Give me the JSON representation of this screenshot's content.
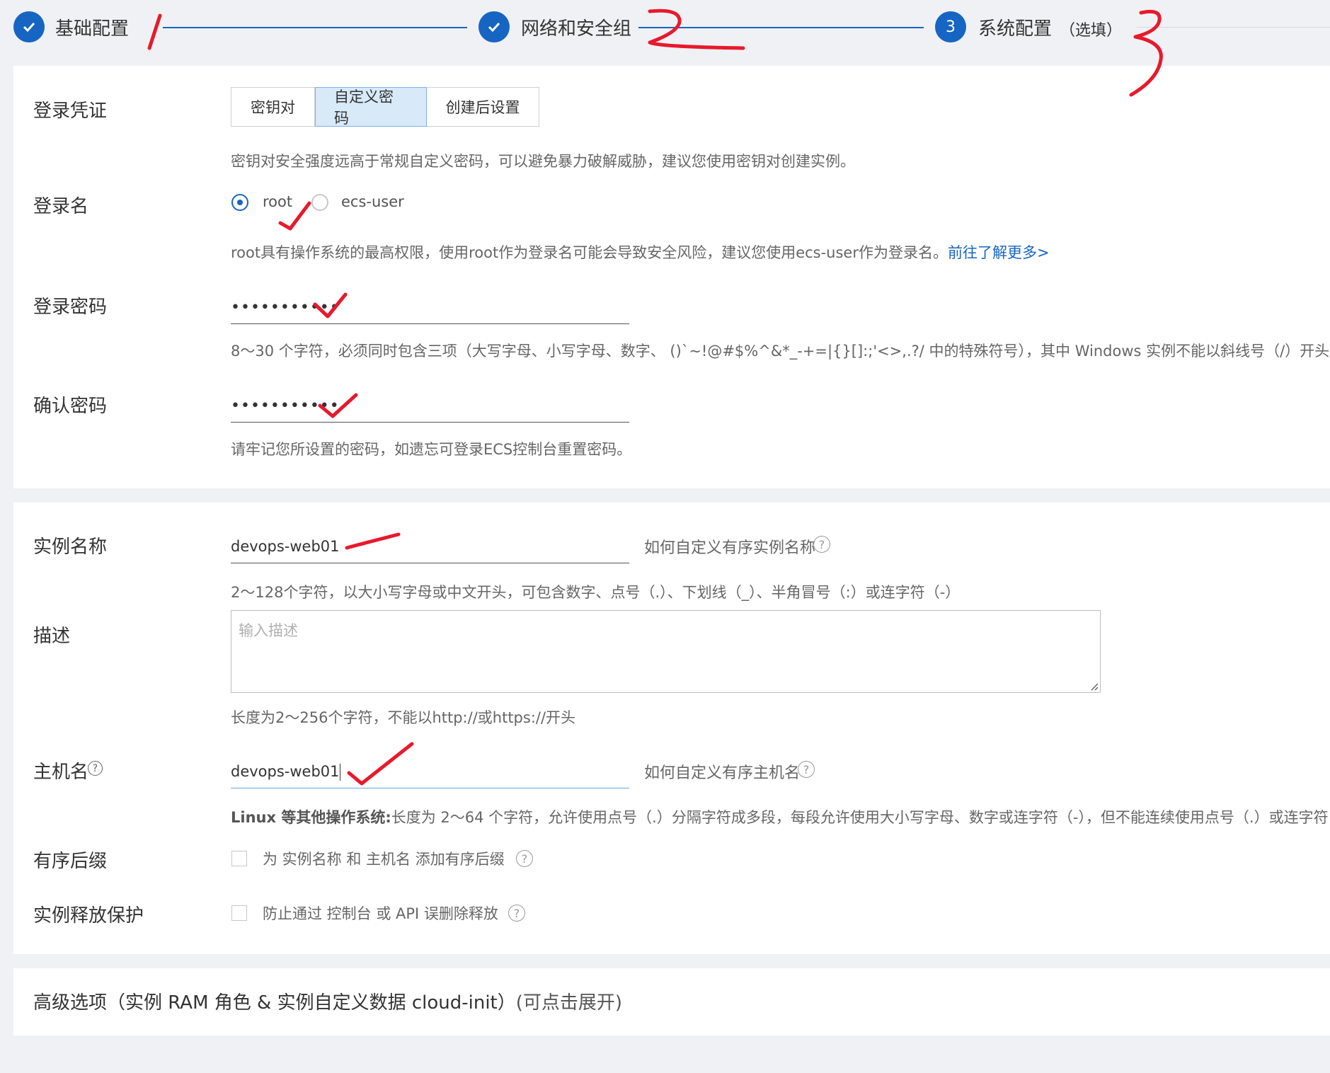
{
  "steps": [
    {
      "label": "基础配置",
      "state": "done"
    },
    {
      "label": "网络和安全组",
      "state": "done"
    },
    {
      "label": "系统配置",
      "number": "3",
      "optional": "（选填）",
      "state": "current"
    }
  ],
  "login": {
    "credential_label": "登录凭证",
    "credential_options": [
      "密钥对",
      "自定义密码",
      "创建后设置"
    ],
    "credential_selected": "自定义密码",
    "credential_hint": "密钥对安全强度远高于常规自定义密码，可以避免暴力破解威胁，建议您使用密钥对创建实例。",
    "username_label": "登录名",
    "username_options": [
      "root",
      "ecs-user"
    ],
    "username_selected": "root",
    "username_hint": "root具有操作系统的最高权限，使用root作为登录名可能会导致安全风险，建议您使用ecs-user作为登录名。",
    "username_link": "前往了解更多>",
    "password_label": "登录密码",
    "password_value": "•••••••••••",
    "password_hint": "8～30 个字符，必须同时包含三项（大写字母、小写字母、数字、 ()`~!@#$%^&*_-+=|{}[]:;'<>,.?/ 中的特殊符号），其中 Windows 实例不能以斜线号（/）开头",
    "confirm_label": "确认密码",
    "confirm_value": "•••••••••••",
    "confirm_hint": "请牢记您所设置的密码，如遗忘可登录ECS控制台重置密码。"
  },
  "instance": {
    "name_label": "实例名称",
    "name_value": "devops-web01",
    "name_help": "如何自定义有序实例名称",
    "name_hint": "2～128个字符，以大小写字母或中文开头，可包含数字、点号（.）、下划线（_）、半角冒号（:）或连字符（-）",
    "desc_label": "描述",
    "desc_placeholder": "输入描述",
    "desc_hint": "长度为2～256个字符，不能以http://或https://开头",
    "hostname_label": "主机名",
    "hostname_value": "devops-web01",
    "hostname_help": "如何自定义有序主机名",
    "hostname_hint_bold": "Linux 等其他操作系统:",
    "hostname_hint": "长度为 2～64 个字符，允许使用点号（.）分隔字符成多段，每段允许使用大小写字母、数字或连字符（-），但不能连续使用点号（.）或连字符",
    "suffix_label": "有序后缀",
    "suffix_checkbox": "为 实例名称 和 主机名 添加有序后缀",
    "protect_label": "实例释放保护",
    "protect_checkbox": "防止通过 控制台 或 API 误删除释放"
  },
  "advanced": {
    "title": "高级选项（实例 RAM 角色 & 实例自定义数据 cloud-init）",
    "expand": "(可点击展开)"
  },
  "colors": {
    "accent": "#1765c3",
    "annotation": "#e8192c"
  }
}
